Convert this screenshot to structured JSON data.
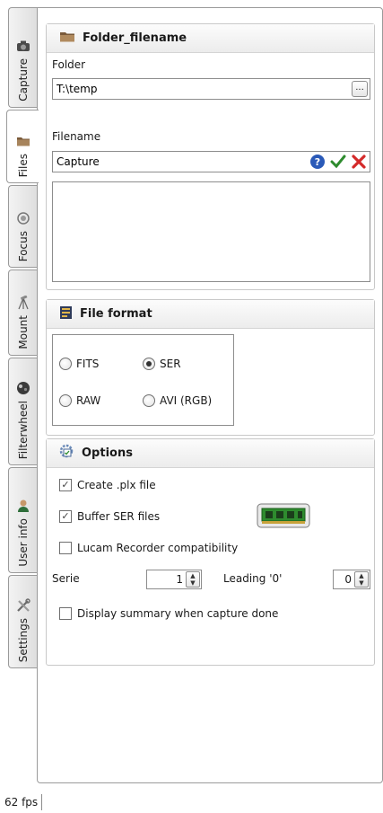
{
  "tabs": [
    {
      "label": "Capture",
      "icon": "camera-icon"
    },
    {
      "label": "Files",
      "icon": "folder-icon",
      "active": true
    },
    {
      "label": "Focus",
      "icon": "target-icon"
    },
    {
      "label": "Mount",
      "icon": "telescope-icon"
    },
    {
      "label": "Filterwheel",
      "icon": "filterwheel-icon"
    },
    {
      "label": "User info",
      "icon": "user-icon"
    },
    {
      "label": "Settings",
      "icon": "tools-icon"
    }
  ],
  "folder_group": {
    "title": "Folder_filename",
    "folder_label": "Folder",
    "folder_value": "T:\\temp",
    "browse_label": "...",
    "filename_label": "Filename",
    "filename_value": "Capture"
  },
  "format_group": {
    "title": "File format",
    "options": [
      "FITS",
      "SER",
      "RAW",
      "AVI (RGB)"
    ],
    "selected": "SER"
  },
  "options_group": {
    "title": "Options",
    "create_plx": {
      "label": "Create .plx file",
      "checked": true
    },
    "buffer_ser": {
      "label": "Buffer SER files",
      "checked": true
    },
    "lucam": {
      "label": "Lucam Recorder compatibility",
      "checked": false
    },
    "serie_label": "Serie",
    "serie_value": "1",
    "leading_label": "Leading '0'",
    "leading_value": "0",
    "summary": {
      "label": "Display summary when capture done",
      "checked": false
    }
  },
  "status": {
    "fps": "62 fps"
  },
  "colors": {
    "accent_green": "#2e8b2e",
    "cancel_red": "#d42a2a",
    "help_blue": "#2a5ab8"
  }
}
